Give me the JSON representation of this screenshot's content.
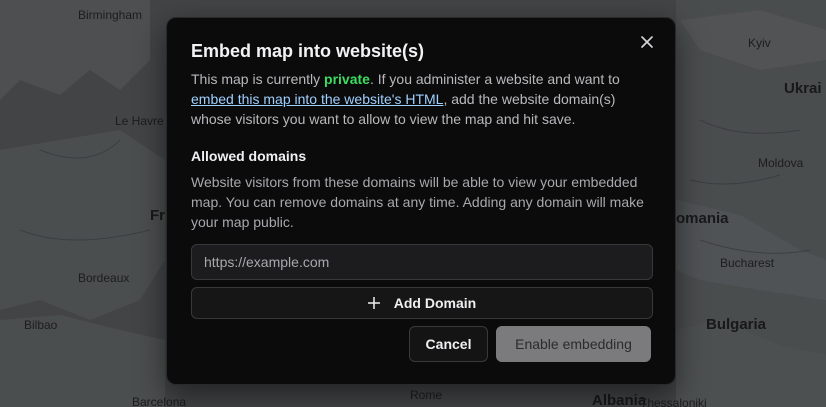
{
  "map": {
    "cities": [
      "Birmingham",
      "Le Havre",
      "Bordeaux",
      "Bilbao",
      "Barcelona",
      "Kyiv",
      "Moldova",
      "Bucharest",
      "Bulgaria",
      "Rome",
      "Albania",
      "Thessaloniki"
    ],
    "countries": [
      "Ukrai",
      "Fr",
      "omania"
    ]
  },
  "modal": {
    "title": "Embed map into website(s)",
    "desc_pre": "This map is currently ",
    "private_word": "private",
    "desc_mid": ". If you administer a website and want to ",
    "link_text": "embed this map into the website's HTML",
    "desc_post": ", add the website domain(s) whose visitors you want to allow to view the map and hit save.",
    "section_title": "Allowed domains",
    "section_desc": "Website visitors from these domains will be able to view your embedded map. You can remove domains at any time. Adding any domain will make your map public.",
    "input": {
      "value": "",
      "placeholder": "https://example.com"
    },
    "add_domain_label": "Add Domain",
    "cancel_label": "Cancel",
    "enable_label": "Enable embedding"
  },
  "colors": {
    "accent_green": "#3ddc60",
    "link_blue": "#9fd0ff",
    "modal_bg": "#0b0b0c"
  },
  "icons": {
    "close": "close-icon",
    "add": "plus-icon"
  }
}
